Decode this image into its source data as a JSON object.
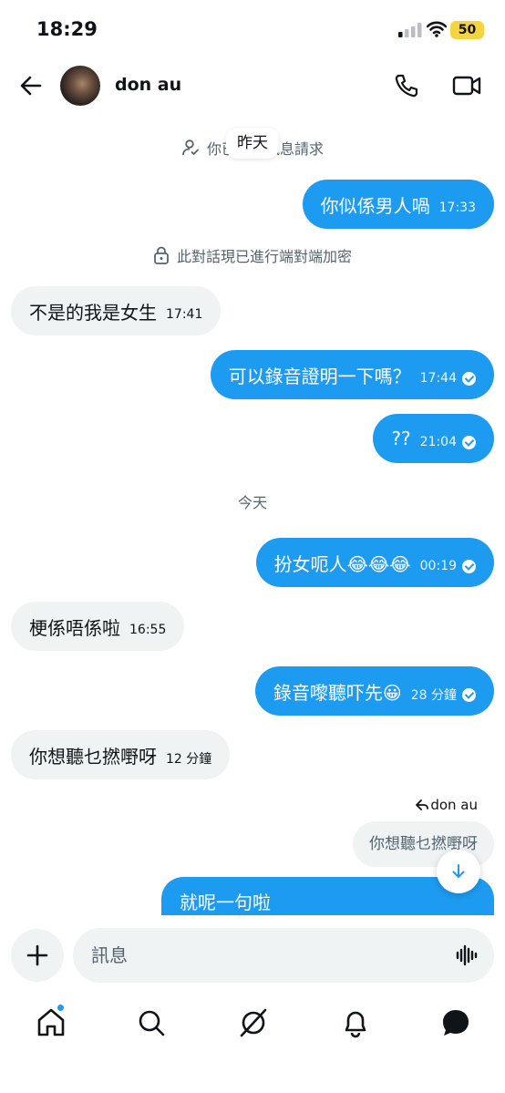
{
  "status_bar": {
    "time": "18:29",
    "battery": "50"
  },
  "header": {
    "name": "don au"
  },
  "system": {
    "request_text": "你已接受訊息請求",
    "floating_date": "昨天",
    "encryption_text": "此對話現已進行端對端加密",
    "today_label": "今天"
  },
  "messages": [
    {
      "dir": "out",
      "text": "你似係男人喎",
      "time": "17:33"
    },
    {
      "dir": "in",
      "text": "不是的我是女生",
      "time": "17:41"
    },
    {
      "dir": "out",
      "text": "可以錄音證明一下嗎？",
      "time": "17:44"
    },
    {
      "dir": "out",
      "text": "??",
      "time": "21:04"
    },
    {
      "dir": "out",
      "text": "扮女呃人😂😂😂",
      "time": "00:19"
    },
    {
      "dir": "in",
      "text": "梗係唔係啦",
      "time": "16:55"
    },
    {
      "dir": "out",
      "text": "錄音嚟聽吓先😀",
      "time": "28 分鐘"
    },
    {
      "dir": "in",
      "text": "你想聽乜撚嘢呀",
      "time": "12 分鐘"
    }
  ],
  "reply": {
    "label": "don au",
    "quoted": "你想聽乜撚嘢呀",
    "text": "就呢一句啦"
  },
  "composer": {
    "placeholder": "訊息"
  },
  "colors": {
    "accent": "#1d9bf0",
    "incoming": "#eff3f4",
    "muted": "#536471"
  },
  "icons": {
    "back": "arrow-left-icon",
    "call": "phone-icon",
    "video": "video-camera-icon",
    "voice": "waveform-icon",
    "tabs": [
      "home-icon",
      "search-icon",
      "grok-icon",
      "bell-icon",
      "messages-icon"
    ]
  }
}
